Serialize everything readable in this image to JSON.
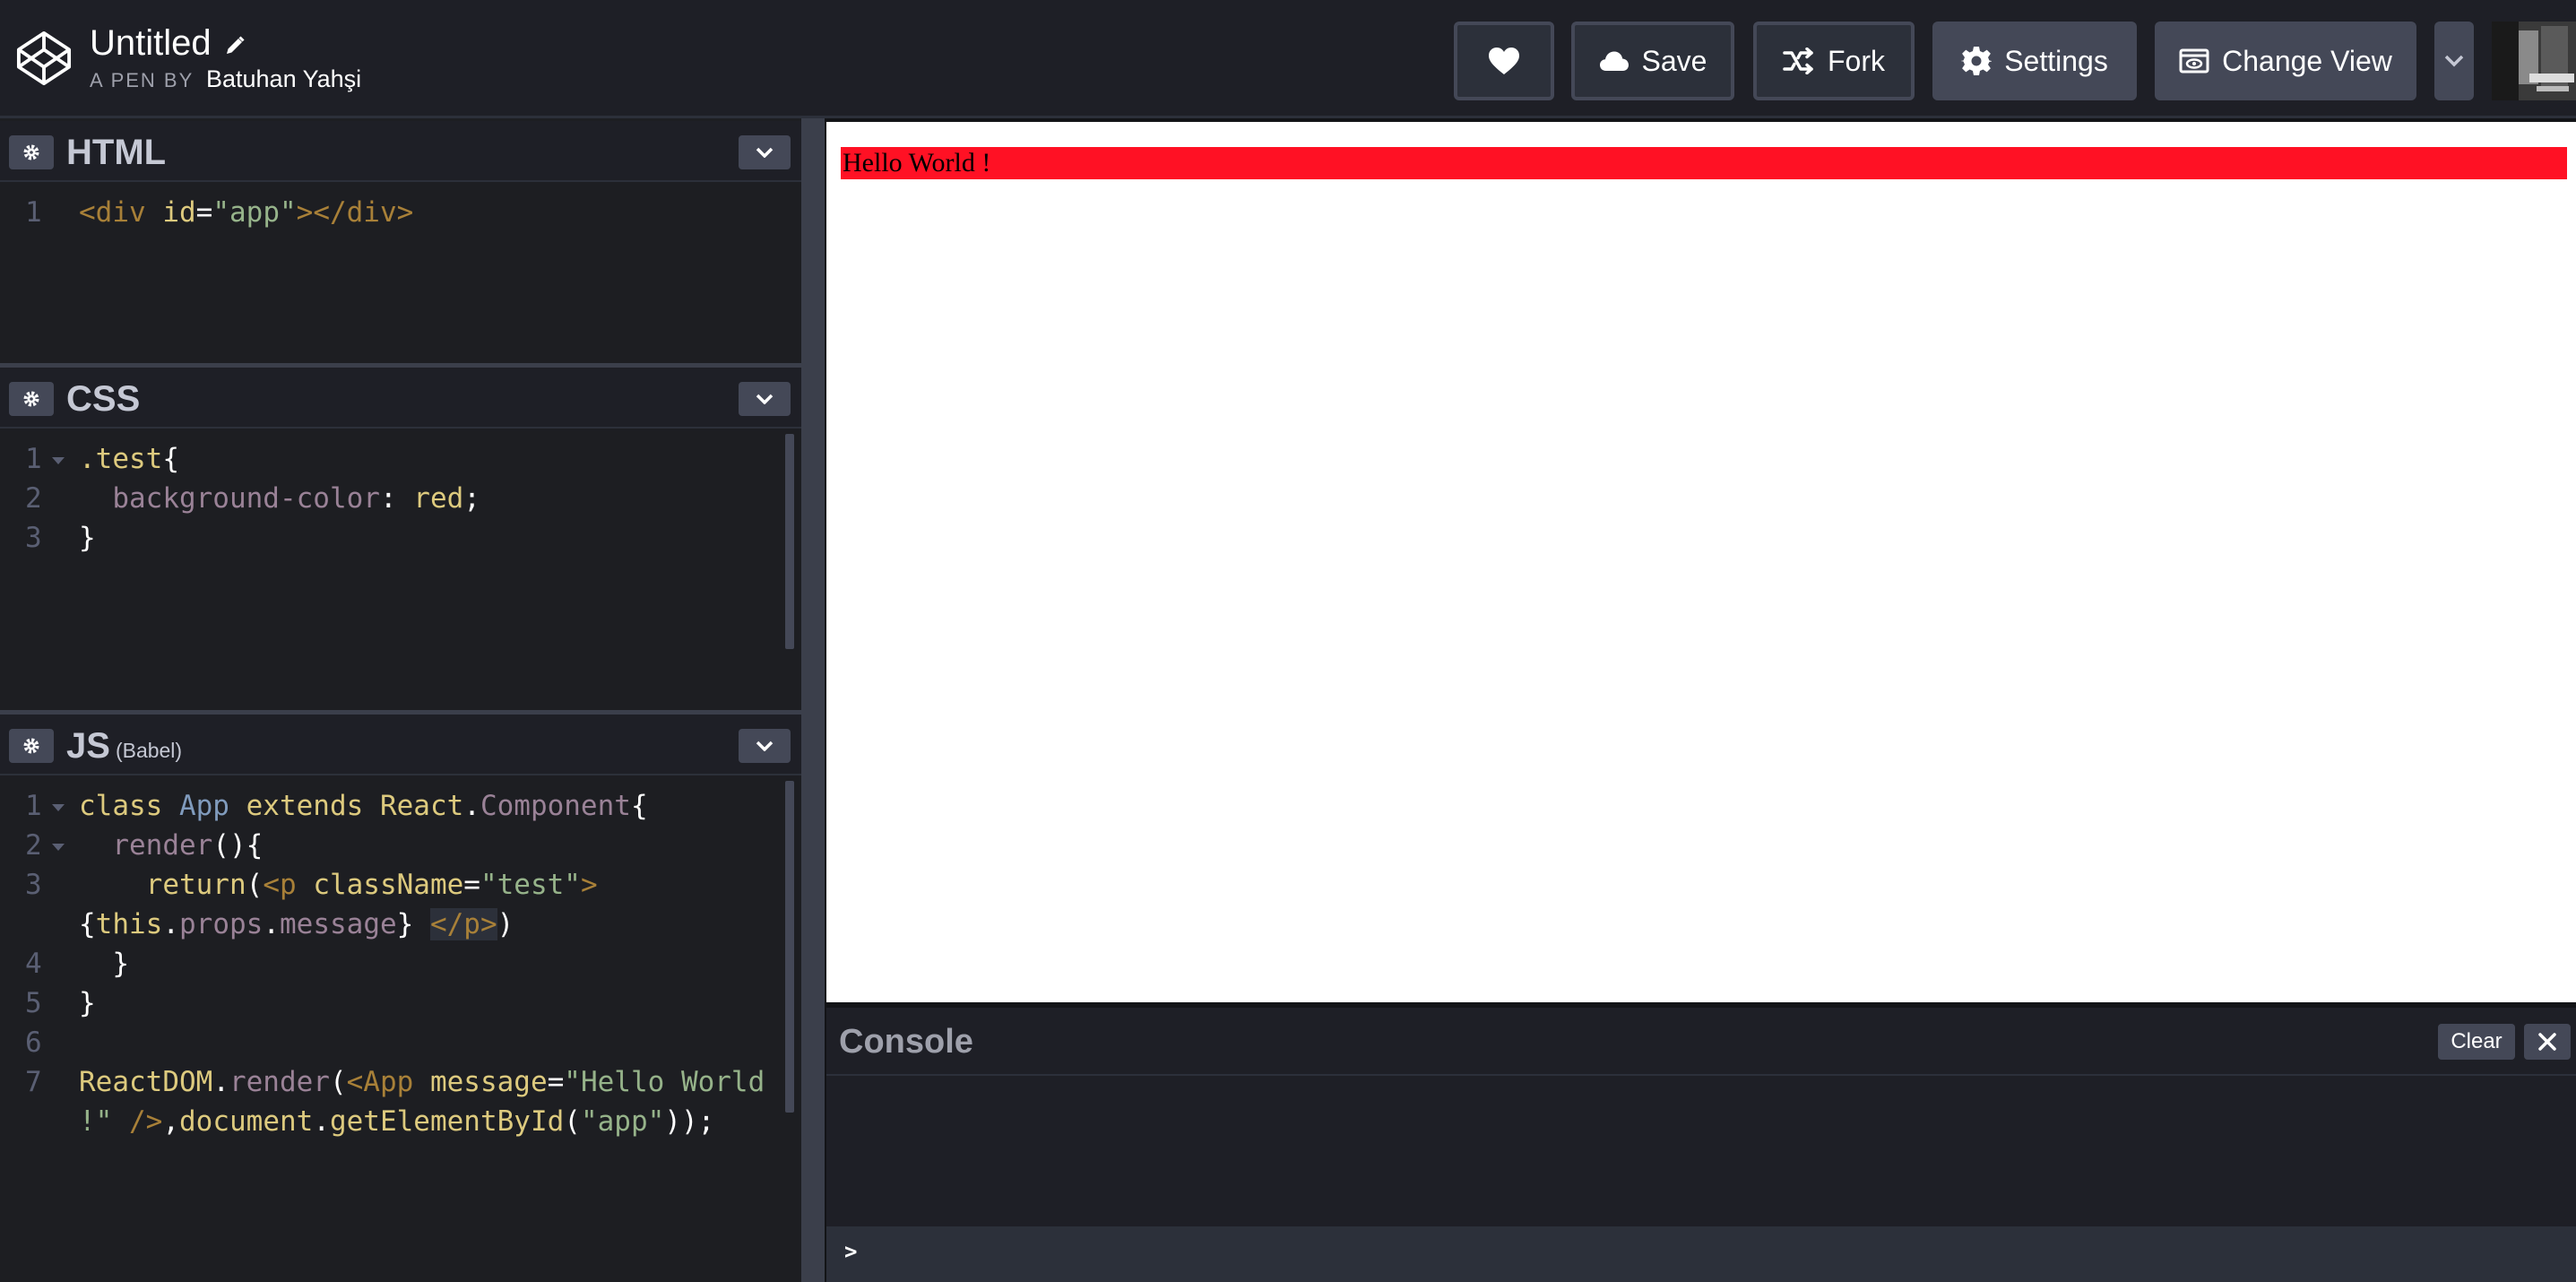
{
  "header": {
    "title": "Untitled",
    "pen_by_prefix": "A PEN BY",
    "author": "Batuhan Yahşi",
    "buttons": {
      "save": "Save",
      "fork": "Fork",
      "settings": "Settings",
      "change_view": "Change View"
    },
    "icons": {
      "logo": "codepen-logo-icon",
      "edit": "pencil-icon",
      "like": "heart-icon",
      "save": "cloud-icon",
      "fork": "fork-icon",
      "settings": "gear-icon",
      "change_view": "eye-window-icon",
      "dropdown": "chevron-down-icon"
    }
  },
  "editors": {
    "html": {
      "title": "HTML",
      "lines": [
        {
          "n": "1",
          "tokens": [
            {
              "t": "<div ",
              "c": "t-tag"
            },
            {
              "t": "id",
              "c": "t-attr"
            },
            {
              "t": "=",
              "c": "t-plain"
            },
            {
              "t": "\"app\"",
              "c": "t-str"
            },
            {
              "t": "></div>",
              "c": "t-tag"
            }
          ]
        }
      ]
    },
    "css": {
      "title": "CSS",
      "lines": [
        {
          "n": "1",
          "fold": true,
          "tokens": [
            {
              "t": ".test",
              "c": "t-sel"
            },
            {
              "t": "{",
              "c": "t-plain"
            }
          ]
        },
        {
          "n": "2",
          "tokens": [
            {
              "t": "  background-color",
              "c": "t-prop"
            },
            {
              "t": ": ",
              "c": "t-plain"
            },
            {
              "t": "red",
              "c": "t-val"
            },
            {
              "t": ";",
              "c": "t-plain"
            }
          ]
        },
        {
          "n": "3",
          "tokens": [
            {
              "t": "}",
              "c": "t-plain"
            }
          ]
        }
      ]
    },
    "js": {
      "title": "JS",
      "subtitle": "(Babel)",
      "lines": [
        {
          "n": "1",
          "fold": true,
          "tokens": [
            {
              "t": "class ",
              "c": "t-kw"
            },
            {
              "t": "App ",
              "c": "t-cls"
            },
            {
              "t": "extends ",
              "c": "t-kw"
            },
            {
              "t": "React",
              "c": "t-kw"
            },
            {
              "t": ".",
              "c": "t-plain"
            },
            {
              "t": "Component",
              "c": "t-mute"
            },
            {
              "t": "{",
              "c": "t-plain"
            }
          ]
        },
        {
          "n": "2",
          "fold": true,
          "tokens": [
            {
              "t": "  render",
              "c": "t-mute"
            },
            {
              "t": "(){",
              "c": "t-plain"
            }
          ]
        },
        {
          "n": "3",
          "tokens": [
            {
              "t": "    return",
              "c": "t-kw"
            },
            {
              "t": "(",
              "c": "t-plain"
            },
            {
              "t": "<p ",
              "c": "t-tag"
            },
            {
              "t": "className",
              "c": "t-attr"
            },
            {
              "t": "=",
              "c": "t-plain"
            },
            {
              "t": "\"test\"",
              "c": "t-str"
            },
            {
              "t": ">",
              "c": "t-tag"
            }
          ]
        },
        {
          "n": "",
          "tokens": [
            {
              "t": "{",
              "c": "t-plain"
            },
            {
              "t": "this",
              "c": "t-kw"
            },
            {
              "t": ".",
              "c": "t-plain"
            },
            {
              "t": "props",
              "c": "t-mute"
            },
            {
              "t": ".",
              "c": "t-plain"
            },
            {
              "t": "message",
              "c": "t-mute"
            },
            {
              "t": "} ",
              "c": "t-plain"
            },
            {
              "t": "</p>",
              "c": "t-tag hl-bg"
            },
            {
              "t": ")",
              "c": "t-plain"
            }
          ]
        },
        {
          "n": "4",
          "tokens": [
            {
              "t": "  }",
              "c": "t-plain"
            }
          ]
        },
        {
          "n": "5",
          "tokens": [
            {
              "t": "}",
              "c": "t-plain"
            }
          ]
        },
        {
          "n": "6",
          "tokens": []
        },
        {
          "n": "7",
          "tokens": [
            {
              "t": "ReactDOM",
              "c": "t-kw"
            },
            {
              "t": ".",
              "c": "t-plain"
            },
            {
              "t": "render",
              "c": "t-mute"
            },
            {
              "t": "(",
              "c": "t-plain"
            },
            {
              "t": "<App ",
              "c": "t-tag"
            },
            {
              "t": "message",
              "c": "t-attr"
            },
            {
              "t": "=",
              "c": "t-plain"
            },
            {
              "t": "\"Hello World",
              "c": "t-str"
            }
          ]
        },
        {
          "n": "",
          "tokens": [
            {
              "t": "!\" ",
              "c": "t-str"
            },
            {
              "t": "/>",
              "c": "t-tag"
            },
            {
              "t": ",",
              "c": "t-plain"
            },
            {
              "t": "document",
              "c": "t-kw"
            },
            {
              "t": ".",
              "c": "t-plain"
            },
            {
              "t": "getElementById",
              "c": "t-kw"
            },
            {
              "t": "(",
              "c": "t-plain"
            },
            {
              "t": "\"app\"",
              "c": "t-str"
            },
            {
              "t": "));",
              "c": "t-plain"
            }
          ]
        }
      ]
    }
  },
  "preview": {
    "text": "Hello World !",
    "highlight_color": "#ff1124"
  },
  "console": {
    "title": "Console",
    "clear_label": "Clear",
    "prompt": ">",
    "close_icon": "close-icon"
  }
}
